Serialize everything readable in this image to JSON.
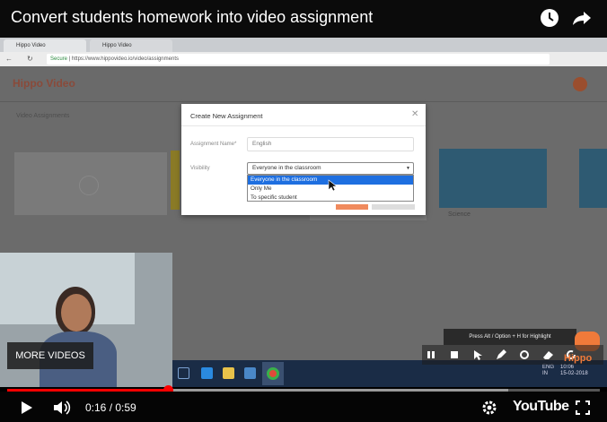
{
  "video_title": "Convert students homework into video assignment",
  "browser": {
    "tabs": [
      {
        "label": "Hippo Video"
      },
      {
        "label": "Hippo Video"
      }
    ],
    "secure_label": "Secure",
    "url": "https://www.hippovideo.io/video/assignments"
  },
  "app": {
    "logo": "Hippo Video",
    "page_heading": "Video Assignments",
    "card_label": "Science"
  },
  "modal": {
    "title": "Create New Assignment",
    "name_label": "Assignment Name*",
    "name_value": "English",
    "visibility_label": "Visibility",
    "visibility_selected": "Everyone in the classroom",
    "visibility_options": [
      {
        "label": "Everyone in the classroom"
      },
      {
        "label": "Only Me"
      },
      {
        "label": "To specific student"
      }
    ]
  },
  "overlay": {
    "more_videos": "MORE VIDEOS",
    "hint": "Press Alt / Option + H for Highlight",
    "watermark": "Hippo"
  },
  "taskbar": {
    "lang_line1": "ENG",
    "lang_line2": "IN",
    "clock_time": "10:06",
    "clock_date": "15-02-2018"
  },
  "player": {
    "time_label": "0:16 / 0:59",
    "progress_fraction": 0.271,
    "buffered_fraction": 0.845,
    "brand": "YouTube"
  },
  "colors": {
    "accent": "#ff0000",
    "select_highlight": "#1e6fe0",
    "taskbar": "#1a2c46"
  }
}
